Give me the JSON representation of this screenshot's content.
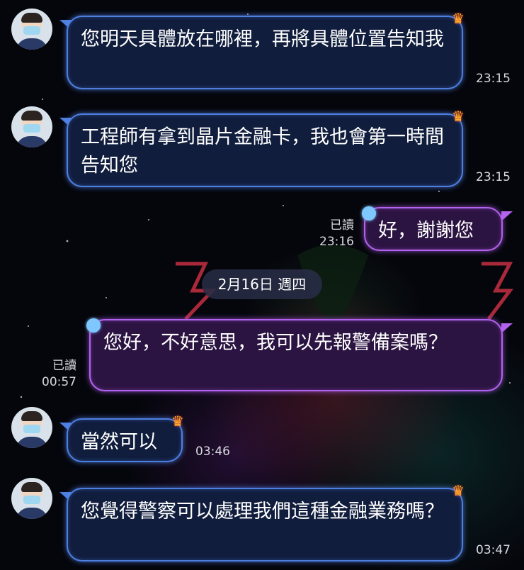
{
  "chat": {
    "messages": [
      {
        "side": "incoming",
        "text": "您明天具體放在哪裡，再將具體位置告知我",
        "time": "23:15"
      },
      {
        "side": "incoming",
        "text": "工程師有拿到晶片金融卡，我也會第一時間告知您",
        "time": "23:15"
      },
      {
        "side": "outgoing",
        "text": "好，謝謝您",
        "read": "已讀",
        "time": "23:16"
      },
      {
        "side": "outgoing",
        "text": "您好，不好意思，我可以先報警備案嗎？",
        "read": "已讀",
        "time": "00:57"
      },
      {
        "side": "incoming",
        "text": "當然可以",
        "time": "03:46"
      },
      {
        "side": "incoming",
        "text": "您覺得警察可以處理我們這種金融業務嗎？",
        "time": "03:47"
      }
    ],
    "date_separator": "2月16日 週四"
  },
  "icons": {
    "crown": "crown-sticker-icon",
    "emote": "blue-creature-sticker-icon"
  },
  "colors": {
    "incoming_bubble": "#101d3d",
    "incoming_border": "#4d7fe0",
    "outgoing_bubble": "#2c1442",
    "outgoing_border": "#b262ee",
    "background": "#05060c"
  }
}
